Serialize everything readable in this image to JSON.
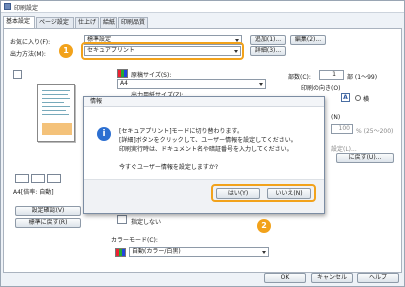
{
  "window": {
    "title": "印刷設定"
  },
  "tabs": [
    "基本設定",
    "ページ設定",
    "仕上げ",
    "給紙",
    "印刷品質"
  ],
  "basic": {
    "favorites_label": "お気に入り(F):",
    "favorites_value": "標準設定",
    "add_button": "追加(1)...",
    "edit_button": "編集(2)...",
    "output_label": "出力方法(M):",
    "output_value": "セキュアプリント",
    "details_button": "詳細(3)...",
    "paper_size_label": "原稿サイズ(S):",
    "paper_size_value": "A4",
    "output_paper_label": "出力用紙サイズ(Z):",
    "copies_label": "部数(C):",
    "copies_value": "1",
    "copies_unit": "部 (1〜99)",
    "orientation_label": "印刷の向き(O)",
    "orientation_option": "横",
    "zoom_hint": "(N)",
    "zoom_value": "100",
    "zoom_unit": "% (25〜200)",
    "zoom_extra": "設定(L)...",
    "preview_caption": "A4[倍率: 自動]",
    "settings_check_button": "設定確認(V)",
    "restore_defaults_button": "標準に戻す(R)",
    "layout_button": "に戻す(U)...",
    "staple_label": "指定しない",
    "color_mode_label": "カラーモード(C):",
    "color_mode_value": "自動(カラー/白黒)"
  },
  "dialog": {
    "title": "情報",
    "lines": [
      "[セキュアプリント]モードに切り替わります。",
      "[詳細]ボタンをクリックして、ユーザー情報を設定してください。",
      "印刷実行時は、ドキュメント名や暗証番号を入力してください。",
      "",
      "今すぐユーザー情報を設定しますか?"
    ],
    "yes_button": "はい(Y)",
    "no_button": "いいえ(N)"
  },
  "footer": {
    "ok_button": "OK",
    "cancel_button": "キャンセル",
    "help_button": "ヘルプ"
  },
  "callouts": [
    "1",
    "2"
  ],
  "colors": {
    "callout": "#f2a21b",
    "info_icon": "#2c6fd1"
  }
}
